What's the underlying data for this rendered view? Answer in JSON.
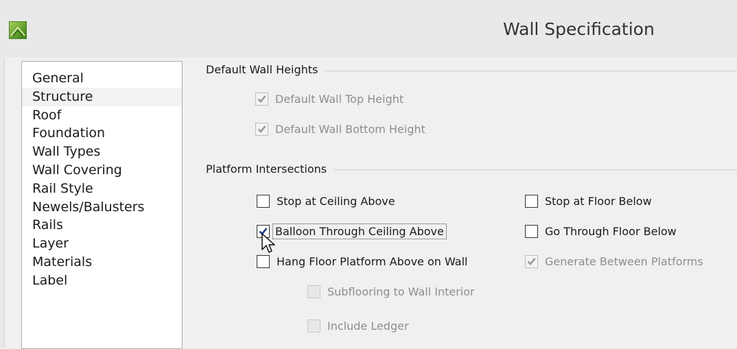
{
  "window": {
    "title": "Wall Specification",
    "app_icon": "chief-architect-app-icon"
  },
  "categories": [
    {
      "label": "General",
      "selected": false
    },
    {
      "label": "Structure",
      "selected": true
    },
    {
      "label": "Roof",
      "selected": false
    },
    {
      "label": "Foundation",
      "selected": false
    },
    {
      "label": "Wall Types",
      "selected": false
    },
    {
      "label": "Wall Covering",
      "selected": false
    },
    {
      "label": "Rail Style",
      "selected": false
    },
    {
      "label": "Newels/Balusters",
      "selected": false
    },
    {
      "label": "Rails",
      "selected": false
    },
    {
      "label": "Layer",
      "selected": false
    },
    {
      "label": "Materials",
      "selected": false
    },
    {
      "label": "Label",
      "selected": false
    }
  ],
  "default_wall_heights": {
    "title": "Default Wall Heights",
    "top_height": {
      "label": "Default Wall Top Height",
      "checked": true,
      "enabled": false
    },
    "bottom_height": {
      "label": "Default Wall Bottom Height",
      "checked": true,
      "enabled": false
    }
  },
  "platform_intersections": {
    "title": "Platform Intersections",
    "stop_at_ceiling": {
      "label": "Stop at Ceiling Above",
      "checked": false,
      "enabled": true
    },
    "balloon_through": {
      "label": "Balloon Through Ceiling Above",
      "checked": true,
      "enabled": true
    },
    "hang_floor": {
      "label": "Hang Floor Platform Above on Wall",
      "checked": false,
      "enabled": true
    },
    "subflooring": {
      "label": "Subflooring to Wall Interior",
      "checked": false,
      "enabled": false
    },
    "include_ledger": {
      "label": "Include Ledger",
      "checked": false,
      "enabled": false
    },
    "stop_at_floor": {
      "label": "Stop at Floor Below",
      "checked": false,
      "enabled": true
    },
    "go_through_floor": {
      "label": "Go Through Floor Below",
      "checked": false,
      "enabled": true
    },
    "generate_between": {
      "label": "Generate Between Platforms",
      "checked": true,
      "enabled": false
    }
  },
  "colors": {
    "check_enabled": "#1e3f8a",
    "check_disabled": "#9a9a9a"
  }
}
